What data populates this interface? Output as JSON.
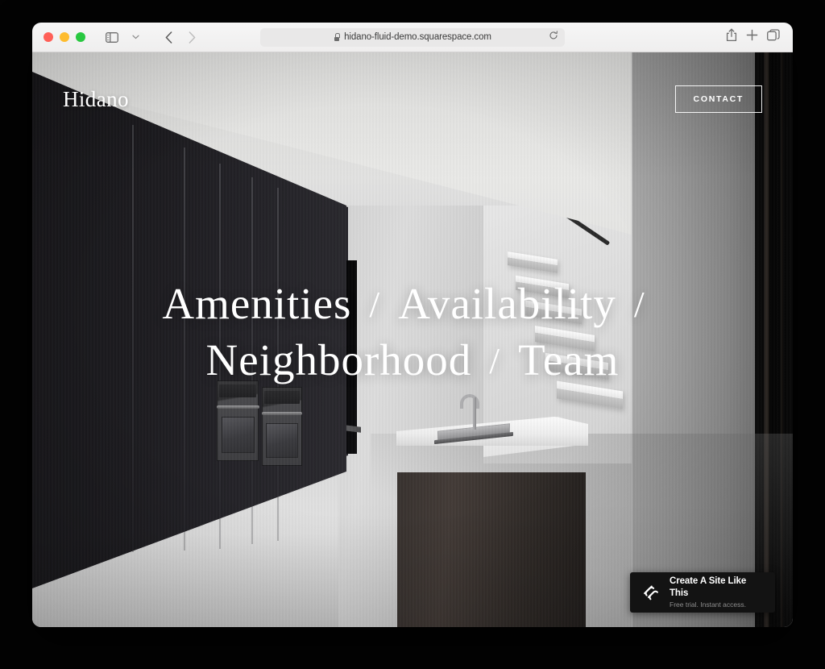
{
  "browser": {
    "name": "safari",
    "url": "hidano-fluid-demo.squarespace.com",
    "lock_icon": "lock-icon",
    "reload_icon": "reload-icon",
    "sidebar_icon": "sidebar-toggle-icon",
    "sidebar_chevron": "chevron-down-icon",
    "back_icon": "back-arrow-icon",
    "forward_icon": "forward-arrow-icon",
    "share_icon": "share-icon",
    "new_tab_icon": "plus-icon",
    "tab_overview_icon": "tab-overview-icon",
    "traffic_lights": {
      "close": "#ff5f57",
      "minimize": "#febc2e",
      "maximize": "#28c840"
    }
  },
  "site": {
    "logo": "Hidano",
    "contact_label": "CONTACT",
    "nav_rows": [
      {
        "items": [
          "Amenities",
          "Availability"
        ],
        "trailing_separator": "/"
      },
      {
        "items": [
          "Neighborhood",
          "Team"
        ],
        "trailing_separator": ""
      }
    ],
    "separator": "/",
    "accent_text_color": "#ffffff"
  },
  "badge": {
    "title": "Create A Site Like This",
    "subtitle": "Free trial. Instant access.",
    "logo_icon": "squarespace-logo-icon",
    "background": "#131313"
  }
}
